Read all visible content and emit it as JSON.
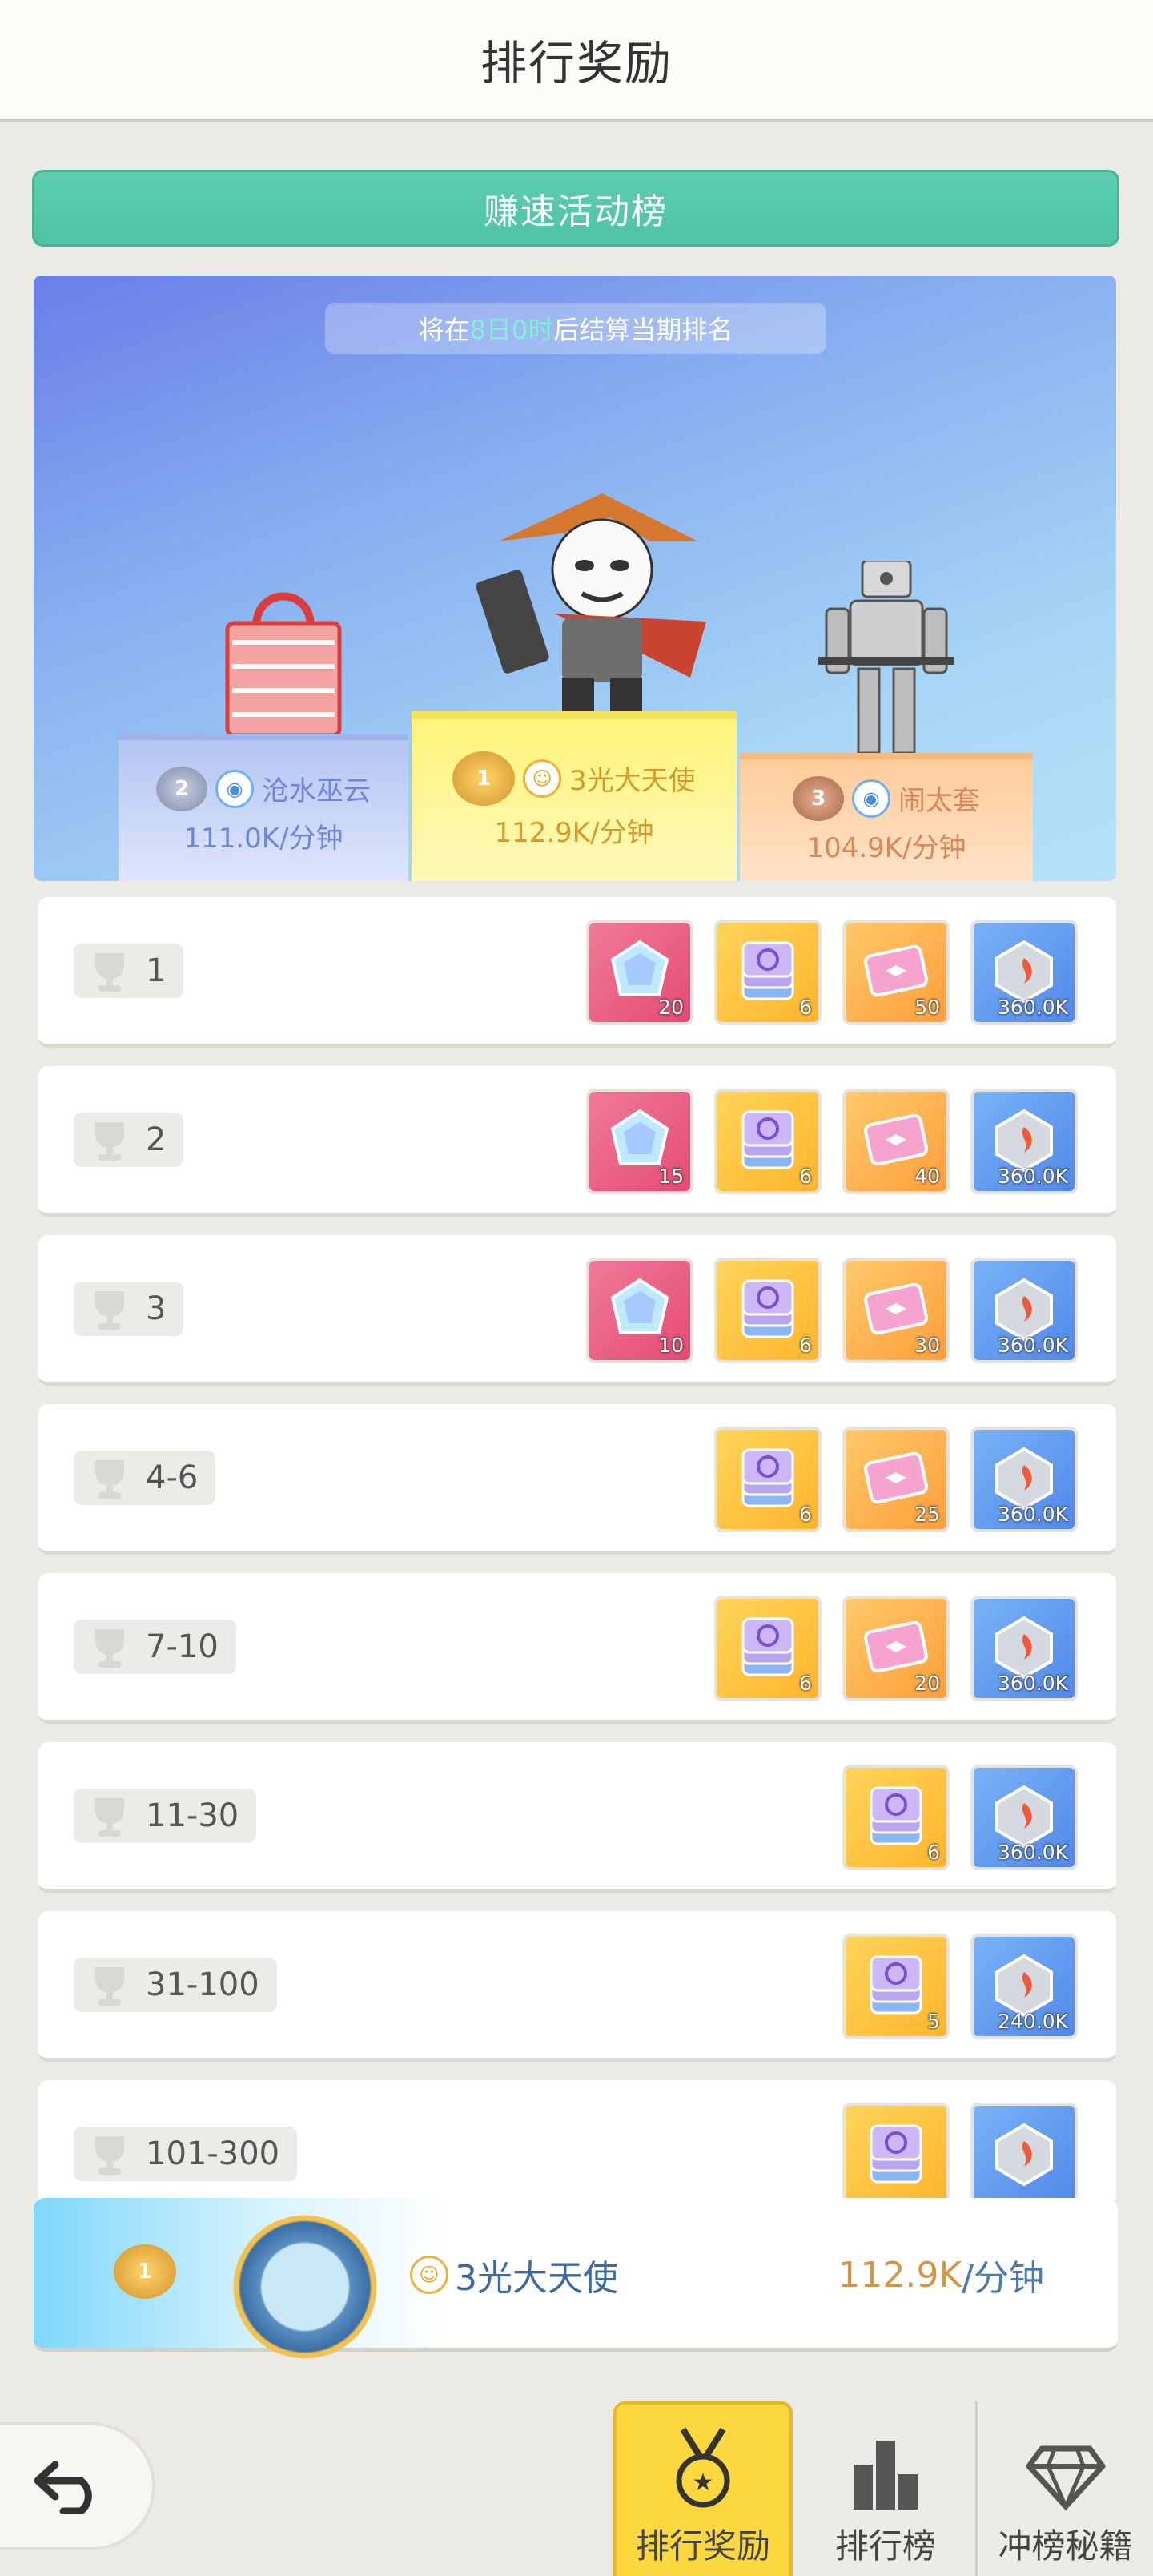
{
  "header": {
    "title": "排行奖励"
  },
  "activity_banner": {
    "label": "赚速活动榜"
  },
  "countdown": {
    "prefix": "将在",
    "highlight": "8日0时",
    "suffix": "后结算当期排名"
  },
  "podium": [
    {
      "rank": "2",
      "name": "沧水巫云",
      "score": "111.0K/分钟"
    },
    {
      "rank": "1",
      "name": "3光大天使",
      "score": "112.9K/分钟"
    },
    {
      "rank": "3",
      "name": "闹太套",
      "score": "104.9K/分钟"
    }
  ],
  "rewards": [
    {
      "rank": "1",
      "items": [
        {
          "type": "gem-icon",
          "qty": "20"
        },
        {
          "type": "card-pack-icon",
          "qty": "6"
        },
        {
          "type": "ticket-icon",
          "qty": "50"
        },
        {
          "type": "crystal-icon",
          "qty": "360.0K"
        }
      ]
    },
    {
      "rank": "2",
      "items": [
        {
          "type": "gem-icon",
          "qty": "15"
        },
        {
          "type": "card-pack-icon",
          "qty": "6"
        },
        {
          "type": "ticket-icon",
          "qty": "40"
        },
        {
          "type": "crystal-icon",
          "qty": "360.0K"
        }
      ]
    },
    {
      "rank": "3",
      "items": [
        {
          "type": "gem-icon",
          "qty": "10"
        },
        {
          "type": "card-pack-icon",
          "qty": "6"
        },
        {
          "type": "ticket-icon",
          "qty": "30"
        },
        {
          "type": "crystal-icon",
          "qty": "360.0K"
        }
      ]
    },
    {
      "rank": "4-6",
      "items": [
        {
          "type": "card-pack-icon",
          "qty": "6"
        },
        {
          "type": "ticket-icon",
          "qty": "25"
        },
        {
          "type": "crystal-icon",
          "qty": "360.0K"
        }
      ]
    },
    {
      "rank": "7-10",
      "items": [
        {
          "type": "card-pack-icon",
          "qty": "6"
        },
        {
          "type": "ticket-icon",
          "qty": "20"
        },
        {
          "type": "crystal-icon",
          "qty": "360.0K"
        }
      ]
    },
    {
      "rank": "11-30",
      "items": [
        {
          "type": "card-pack-icon",
          "qty": "6"
        },
        {
          "type": "crystal-icon",
          "qty": "360.0K"
        }
      ]
    },
    {
      "rank": "31-100",
      "items": [
        {
          "type": "card-pack-icon",
          "qty": "5"
        },
        {
          "type": "crystal-icon",
          "qty": "240.0K"
        }
      ]
    },
    {
      "rank": "101-300",
      "items": [
        {
          "type": "card-pack-icon",
          "qty": ""
        },
        {
          "type": "crystal-icon",
          "qty": ""
        }
      ]
    }
  ],
  "my_rank": {
    "rank": "1",
    "name": "3光大天使",
    "score_value": "112.9K",
    "score_unit": "/分钟"
  },
  "tabs": {
    "rewards": "排行奖励",
    "rank": "排行榜",
    "tips": "冲榜秘籍"
  },
  "colors": {
    "accent_green": "#5ecdb0",
    "tab_active": "#fcd73e",
    "score_orange": "#d49546"
  }
}
